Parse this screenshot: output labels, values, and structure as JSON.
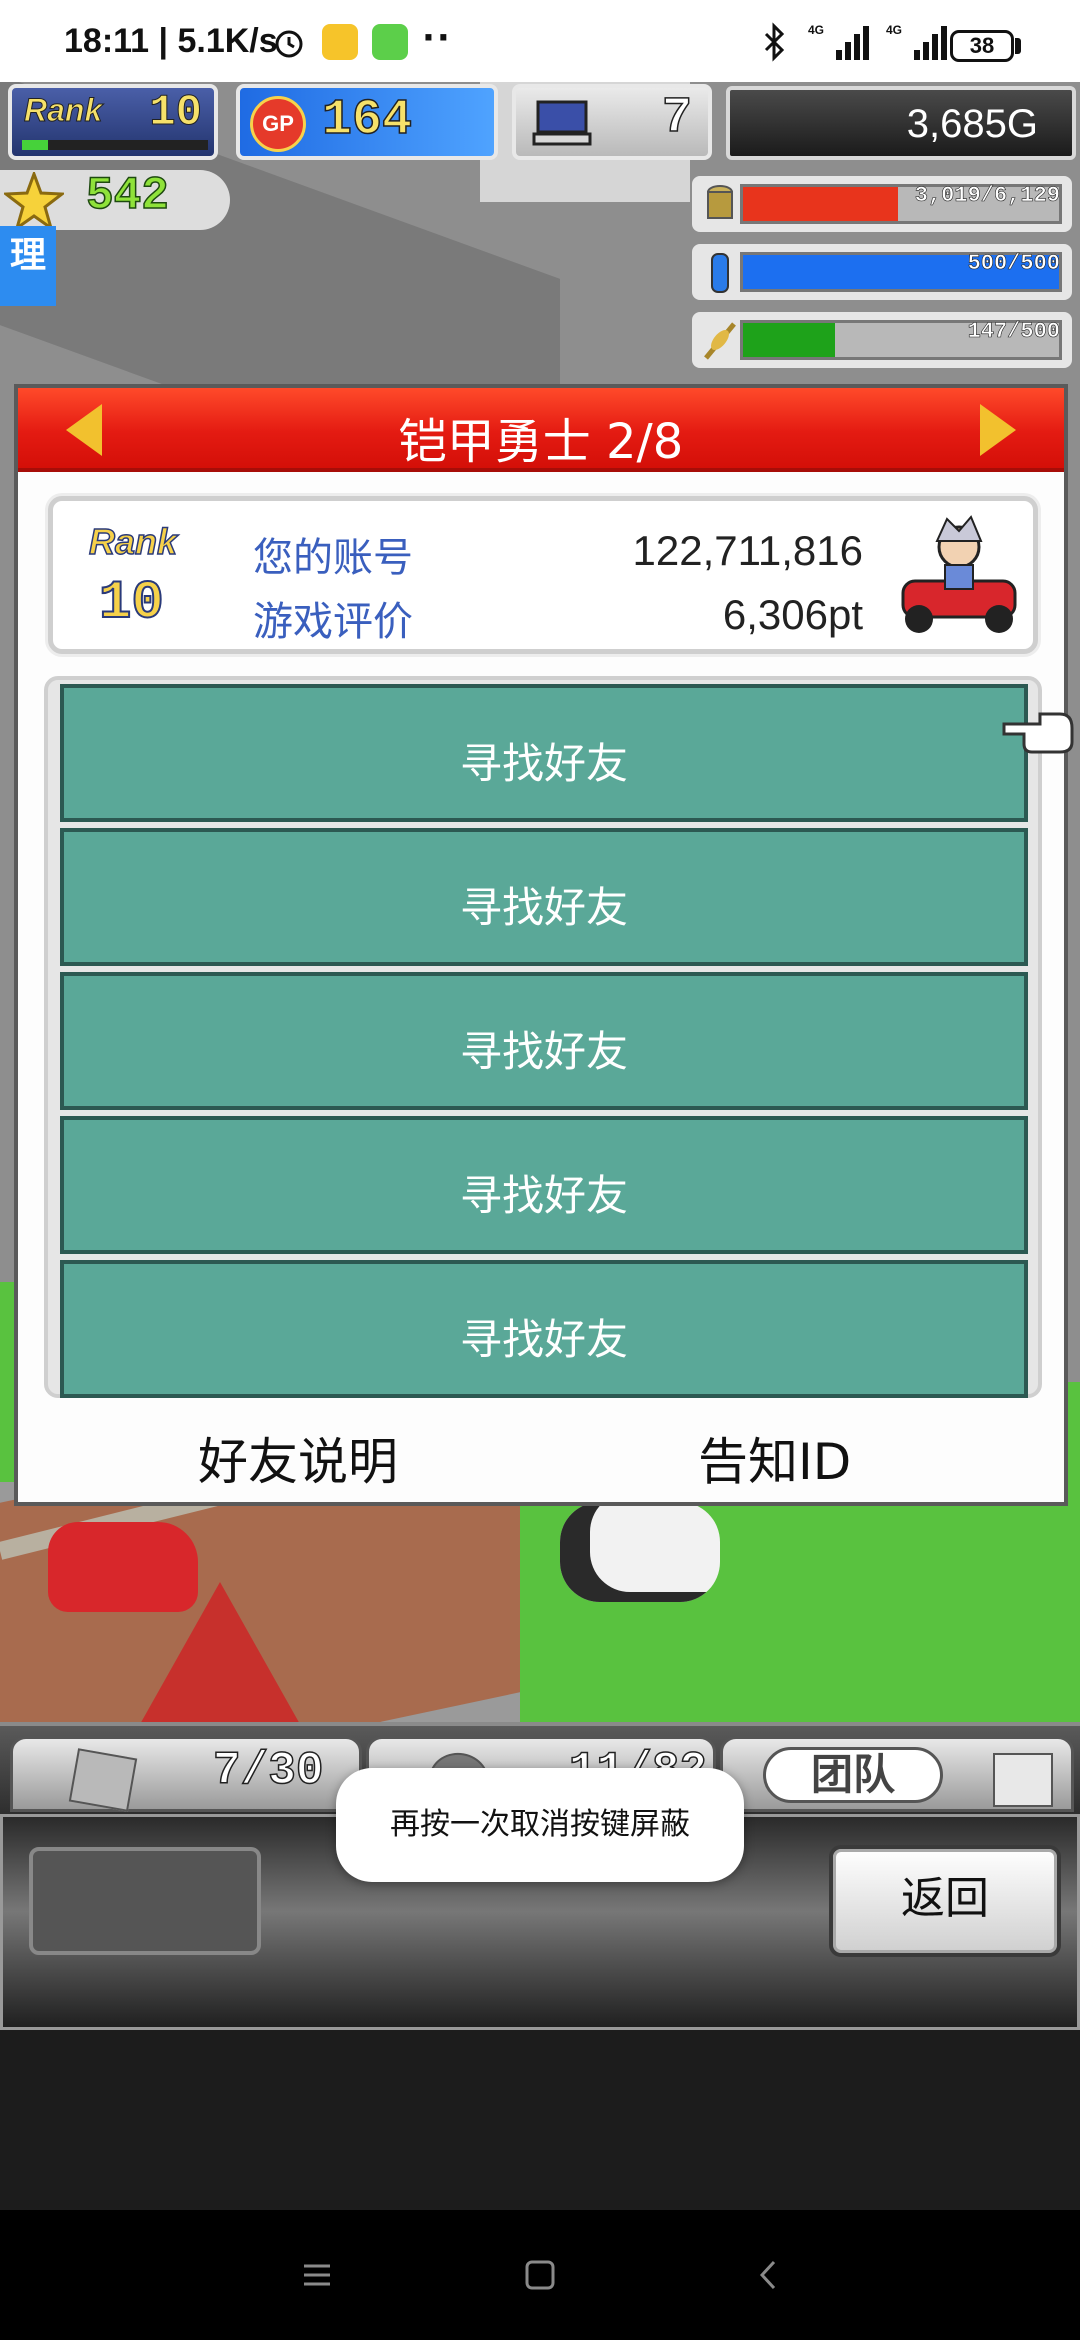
{
  "status_bar": {
    "time": "18:11 | 5.1K/s",
    "more": "··",
    "battery": "38"
  },
  "hud": {
    "rank_label": "Rank",
    "rank_value": "10",
    "gp_label": "GP",
    "gp_value": "164",
    "pc_value": "7",
    "money": "3,685G",
    "stars": "542",
    "resources": [
      {
        "name": "coins",
        "text": "3,019/6,129",
        "fraction": 0.49,
        "color": "#e8341c"
      },
      {
        "name": "fuel",
        "text": "500/500",
        "fraction": 1.0,
        "color": "#1c6ff0"
      },
      {
        "name": "grain",
        "text": "147/500",
        "fraction": 0.29,
        "color": "#1ea21a"
      }
    ],
    "side_label": "理"
  },
  "dialog": {
    "title": "铠甲勇士 2/8",
    "profile": {
      "rank_label": "Rank",
      "rank_value": "10",
      "account_label": "您的账号",
      "account_value": "122,711,816",
      "rating_label": "游戏评价",
      "rating_value": "6,306pt"
    },
    "friend_slots": [
      "寻找好友",
      "寻找好友",
      "寻找好友",
      "寻找好友",
      "寻找好友"
    ],
    "friend_help": "好友说明",
    "notify_id": "告知ID"
  },
  "bottom": {
    "tab1_value": "7/30",
    "tab2_value": "11/82",
    "team_label": "团队",
    "back": "返回"
  },
  "toast": "再按一次取消按键屏蔽"
}
